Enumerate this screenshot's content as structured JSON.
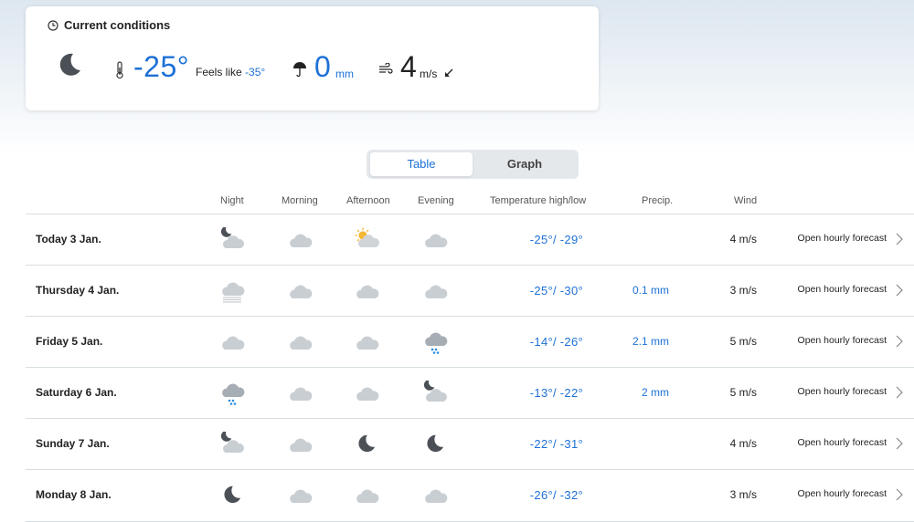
{
  "current": {
    "title": "Current conditions",
    "temperature": "-25°",
    "feels_like_label": "Feels like",
    "feels_like_value": "-35°",
    "precip_value": "0",
    "precip_unit": "mm",
    "wind_value": "4",
    "wind_unit": "m/s"
  },
  "view_toggle": {
    "table_label": "Table",
    "graph_label": "Graph",
    "selected": "Table"
  },
  "columns": {
    "night": "Night",
    "morning": "Morning",
    "afternoon": "Afternoon",
    "evening": "Evening",
    "temperature": "Temperature high/low",
    "precip": "Precip.",
    "wind": "Wind"
  },
  "colors": {
    "accent": "#1d70d6",
    "cloud": "#c9ced3",
    "sun": "#f5b731",
    "moon": "#4b4f56",
    "snow": "#2a8be0"
  },
  "days": [
    {
      "day": "Today 3 Jan.",
      "icons": [
        "moon-cloud-icon",
        "cloud-icon",
        "sun-cloud-icon",
        "cloud-icon"
      ],
      "temp": "-25°/ -29°",
      "precip": "",
      "wind": "4 m/s",
      "link": "Open hourly forecast"
    },
    {
      "day": "Thursday 4 Jan.",
      "icons": [
        "fog-icon",
        "cloud-icon",
        "cloud-icon",
        "cloud-icon"
      ],
      "temp": "-25°/ -30°",
      "precip": "0.1 mm",
      "wind": "3 m/s",
      "link": "Open hourly forecast"
    },
    {
      "day": "Friday 5 Jan.",
      "icons": [
        "cloud-icon",
        "cloud-icon",
        "cloud-icon",
        "snow-cloud-icon"
      ],
      "temp": "-14°/ -26°",
      "precip": "2.1 mm",
      "wind": "5 m/s",
      "link": "Open hourly forecast"
    },
    {
      "day": "Saturday 6 Jan.",
      "icons": [
        "snow-cloud-icon",
        "cloud-icon",
        "cloud-icon",
        "moon-cloud-icon"
      ],
      "temp": "-13°/ -22°",
      "precip": "2 mm",
      "wind": "5 m/s",
      "link": "Open hourly forecast"
    },
    {
      "day": "Sunday 7 Jan.",
      "icons": [
        "moon-cloud-icon",
        "cloud-icon",
        "moon-icon",
        "moon-icon"
      ],
      "temp": "-22°/ -31°",
      "precip": "",
      "wind": "4 m/s",
      "link": "Open hourly forecast"
    },
    {
      "day": "Monday 8 Jan.",
      "icons": [
        "moon-icon",
        "cloud-icon",
        "cloud-icon",
        "cloud-icon"
      ],
      "temp": "-26°/ -32°",
      "precip": "",
      "wind": "3 m/s",
      "link": "Open hourly forecast"
    }
  ]
}
